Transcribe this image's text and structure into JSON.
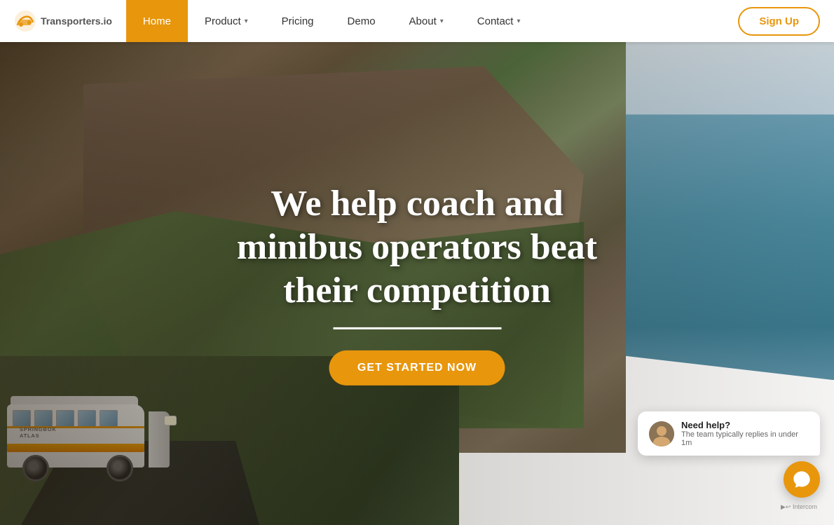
{
  "brand": {
    "logo_text": "Transporters.io",
    "logo_icon": "🚌"
  },
  "navbar": {
    "items": [
      {
        "id": "home",
        "label": "Home",
        "active": true,
        "has_dropdown": false
      },
      {
        "id": "product",
        "label": "Product",
        "active": false,
        "has_dropdown": true
      },
      {
        "id": "pricing",
        "label": "Pricing",
        "active": false,
        "has_dropdown": false
      },
      {
        "id": "demo",
        "label": "Demo",
        "active": false,
        "has_dropdown": false
      },
      {
        "id": "about",
        "label": "About",
        "active": false,
        "has_dropdown": true
      },
      {
        "id": "contact",
        "label": "Contact",
        "active": false,
        "has_dropdown": true
      }
    ],
    "cta_label": "Sign Up"
  },
  "hero": {
    "title": "We help coach and minibus operators beat their competition",
    "cta_label": "GET STARTED NOW"
  },
  "chat": {
    "title": "Need help?",
    "subtitle": "The team typically replies in under 1m",
    "watermark": "▶↩ Intercom"
  },
  "colors": {
    "primary": "#e8960c",
    "nav_active_bg": "#e8960c",
    "nav_active_text": "#ffffff",
    "nav_text": "#333333",
    "white": "#ffffff"
  }
}
